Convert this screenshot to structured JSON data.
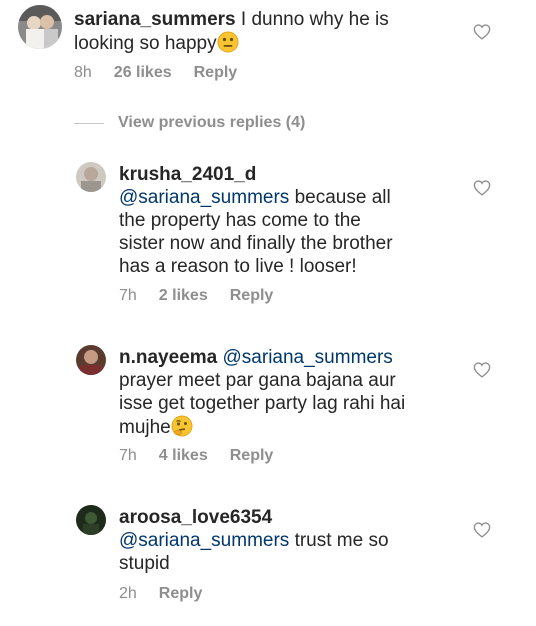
{
  "comments": [
    {
      "username": "sariana_summers",
      "mention": "",
      "text": "I dunno why he is",
      "text2": "looking so happy",
      "emoji": "neutral-face",
      "time": "8h",
      "likes": "26 likes",
      "reply": "Reply"
    },
    {
      "username": "krusha_2401_d",
      "mention": "@sariana_summers",
      "text_after_mention": "because all",
      "line2": "the property has come to the",
      "line3": "sister now and finally the brother",
      "line4": "has a reason to live ! looser!",
      "time": "7h",
      "likes": "2 likes",
      "reply": "Reply"
    },
    {
      "username": "n.nayeema",
      "mention": "@sariana_summers",
      "line2": "prayer meet par gana bajana aur",
      "line3": "isse get together party lag rahi hai",
      "line4": "mujhe",
      "emoji": "thinking-face",
      "time": "7h",
      "likes": "4 likes",
      "reply": "Reply"
    },
    {
      "username": "aroosa_love6354",
      "mention": "@sariana_summers",
      "text_after_mention": "trust me so",
      "line2": "stupid",
      "time": "2h",
      "likes": "",
      "reply": "Reply"
    }
  ],
  "view_replies": "View previous replies (4)",
  "icons": {
    "like": "heart-outline-icon"
  },
  "colors": {
    "text": "#262626",
    "meta": "#8e8e8e",
    "mention": "#00376b"
  }
}
